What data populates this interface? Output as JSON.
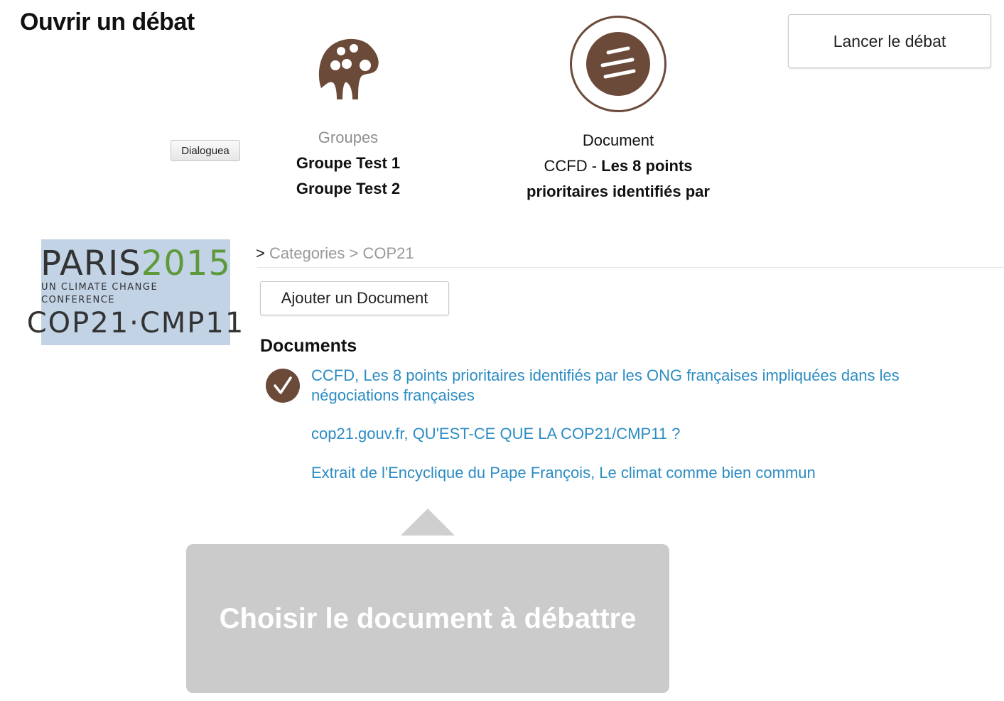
{
  "header": {
    "title": "Ouvrir un débat",
    "launch_label": "Lancer le débat",
    "dialoguea_label": "Dialoguea"
  },
  "groups": {
    "label": "Groupes",
    "icon": "groups-icon",
    "items": [
      "Groupe Test 1",
      "Groupe Test 2"
    ]
  },
  "document": {
    "label": "Document",
    "icon": "document-icon",
    "prefix": "CCFD - ",
    "title_line1": "Les 8 points",
    "title_line2": "prioritaires identifiés par"
  },
  "logo": {
    "paris": "PARIS",
    "year": "2015",
    "subtitle": "UN CLIMATE CHANGE CONFERENCE",
    "cop": "COP21·CMP11"
  },
  "breadcrumb": {
    "sep": ">",
    "items": [
      "Categories",
      "COP21"
    ]
  },
  "content": {
    "add_document_label": "Ajouter un Document",
    "documents_heading": "Documents",
    "documents": [
      {
        "title": "CCFD, Les 8 points prioritaires identifiés par les ONG françaises impliquées dans les négociations françaises",
        "selected": true
      },
      {
        "title": "cop21.gouv.fr, QU'EST-CE QUE LA COP21/CMP11 ?",
        "selected": false
      },
      {
        "title": "Extrait de l'Encyclique du Pape François, Le climat comme bien commun",
        "selected": false
      }
    ]
  },
  "tooltip": {
    "text": "Choisir le document à débattre"
  },
  "colors": {
    "brand_brown": "#6b4a3a",
    "link_blue": "#2c8cc2",
    "tooltip_gray": "#cbcbcb",
    "logo_bg": "#c2d3e6",
    "logo_green": "#5e9a3a"
  }
}
